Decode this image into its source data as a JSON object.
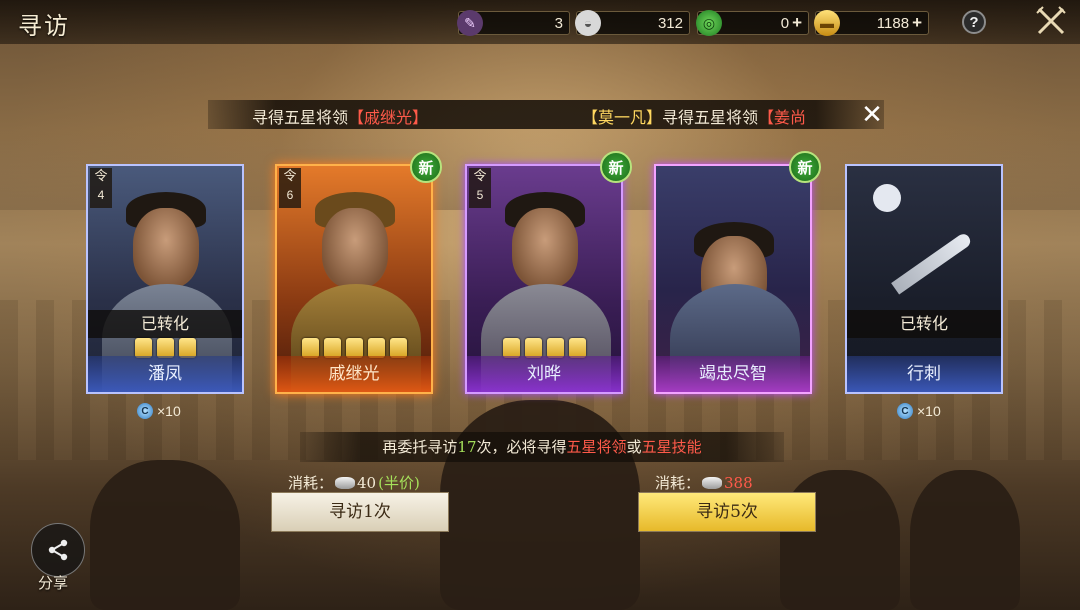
{
  "header": {
    "title": "寻访",
    "resources": [
      {
        "icon": "scroll-token-icon",
        "value": "3",
        "has_plus": false
      },
      {
        "icon": "silver-ingot-icon",
        "value": "312",
        "has_plus": false
      },
      {
        "icon": "jade-coin-icon",
        "value": "0",
        "has_plus": true
      },
      {
        "icon": "gold-ingot-icon",
        "value": "1188",
        "has_plus": true
      }
    ],
    "help_label": "?"
  },
  "ticker": {
    "msg1_prefix": "寻得五星将领",
    "msg1_name": "【戚继光】",
    "msg2_player": "【莫一凡】",
    "msg2_prefix": "寻得五星将领",
    "msg2_name": "【姜尚"
  },
  "cards": [
    {
      "name": "潘凤",
      "rank_label": "令",
      "rank": "4",
      "status": "已转化",
      "stars": 3,
      "is_new": false,
      "frame": "blue"
    },
    {
      "name": "戚继光",
      "rank_label": "令",
      "rank": "6",
      "status": "",
      "stars": 5,
      "is_new": true,
      "frame": "orange"
    },
    {
      "name": "刘晔",
      "rank_label": "令",
      "rank": "5",
      "status": "",
      "stars": 4,
      "is_new": true,
      "frame": "purple"
    },
    {
      "name": "竭忠尽智",
      "rank_label": "",
      "rank": "",
      "status": "",
      "stars": 0,
      "is_new": true,
      "frame": "violet"
    },
    {
      "name": "行刺",
      "rank_label": "",
      "rank": "",
      "status": "已转化",
      "stars": 0,
      "is_new": false,
      "frame": "blue"
    }
  ],
  "new_badge_label": "新",
  "shards": [
    {
      "card": "潘凤",
      "text": "×10"
    },
    {
      "card": "行刺",
      "text": "×10"
    }
  ],
  "guarantee": {
    "part1": "再委托寻访",
    "count": "17",
    "part2": "次，必将寻得",
    "highlight1": "五星将领",
    "part3": "或",
    "highlight2": "五星技能"
  },
  "actions": {
    "single": {
      "cost_label": "消耗：",
      "cost": "40",
      "discount": "(半价)",
      "button": "寻访1次"
    },
    "five": {
      "cost_label": "消耗：",
      "cost": "388",
      "button": "寻访5次"
    }
  },
  "share_label": "分享",
  "colors": {
    "highlight_red": "#ff5a4a",
    "highlight_green": "#a5e05a",
    "gold_button": "#ffe97a"
  }
}
